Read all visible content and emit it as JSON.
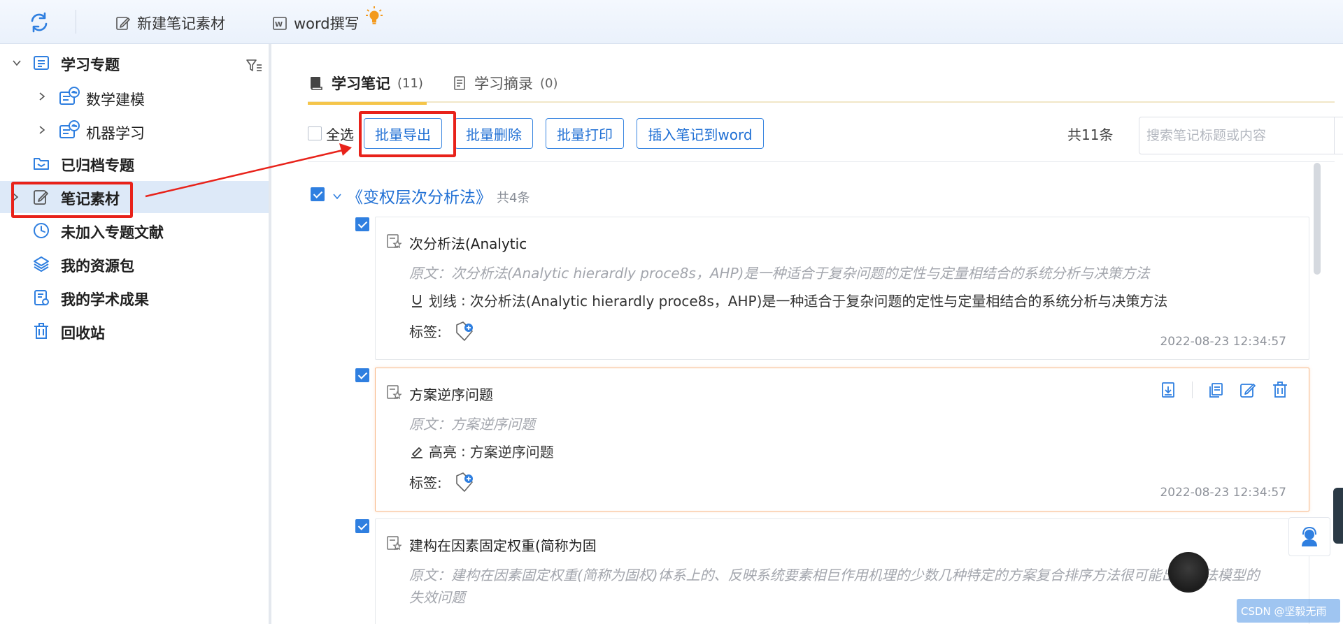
{
  "toolbar": {
    "new_note_label": "新建笔记素材",
    "word_label": "word撰写"
  },
  "sidebar": {
    "items": [
      {
        "label": "学习专题"
      },
      {
        "label": "数学建模"
      },
      {
        "label": "机器学习"
      },
      {
        "label": "已归档专题"
      },
      {
        "label": "笔记素材"
      },
      {
        "label": "未加入专题文献"
      },
      {
        "label": "我的资源包"
      },
      {
        "label": "我的学术成果"
      },
      {
        "label": "回收站"
      }
    ],
    "active_item": "笔记素材"
  },
  "tabs": [
    {
      "label": "学习笔记",
      "count": "(11)"
    },
    {
      "label": "学习摘录",
      "count": "(0)"
    }
  ],
  "actions": {
    "select_all": "全选",
    "batch_export": "批量导出",
    "batch_delete": "批量删除",
    "batch_print": "批量打印",
    "insert_to_word": "插入笔记到word",
    "total": "共11条"
  },
  "search": {
    "placeholder": "搜索笔记标题或内容",
    "value": ""
  },
  "group": {
    "title": "《变权层次分析法》",
    "count": "共4条"
  },
  "notes": [
    {
      "title": "次分析法(Analytic",
      "original": "原文：次分析法(Analytic hierardly proce8s，AHP)是一种适合于复杂问题的定性与定量相结合的系统分析与决策方法",
      "mark_type": "划线",
      "mark_text": "次分析法(Analytic hierardly proce8s，AHP)是一种适合于复杂问题的定性与定量相结合的系统分析与决策方法",
      "tags_label": "标签:",
      "time": "2022-08-23 12:34:57",
      "checked": true
    },
    {
      "title": "方案逆序问题",
      "original": "原文：方案逆序问题",
      "mark_type": "高亮",
      "mark_text": "方案逆序问题",
      "tags_label": "标签:",
      "time": "2022-08-23 12:34:57",
      "checked": true
    },
    {
      "title": "建构在因素固定权重(简称为固",
      "original": "原文：建构在因素固定权重(简称为固权)体系上的、反映系统要素相巨作用机理的少数几种特定的方案复合排序方法很可能出现方法模型的失效问题",
      "checked": true
    }
  ],
  "watermark": "CSDN @坚毅无雨",
  "colors": {
    "accent": "#2f7fe0",
    "highlight_border": "#e8221a",
    "tab_underline": "#f5c54a"
  }
}
